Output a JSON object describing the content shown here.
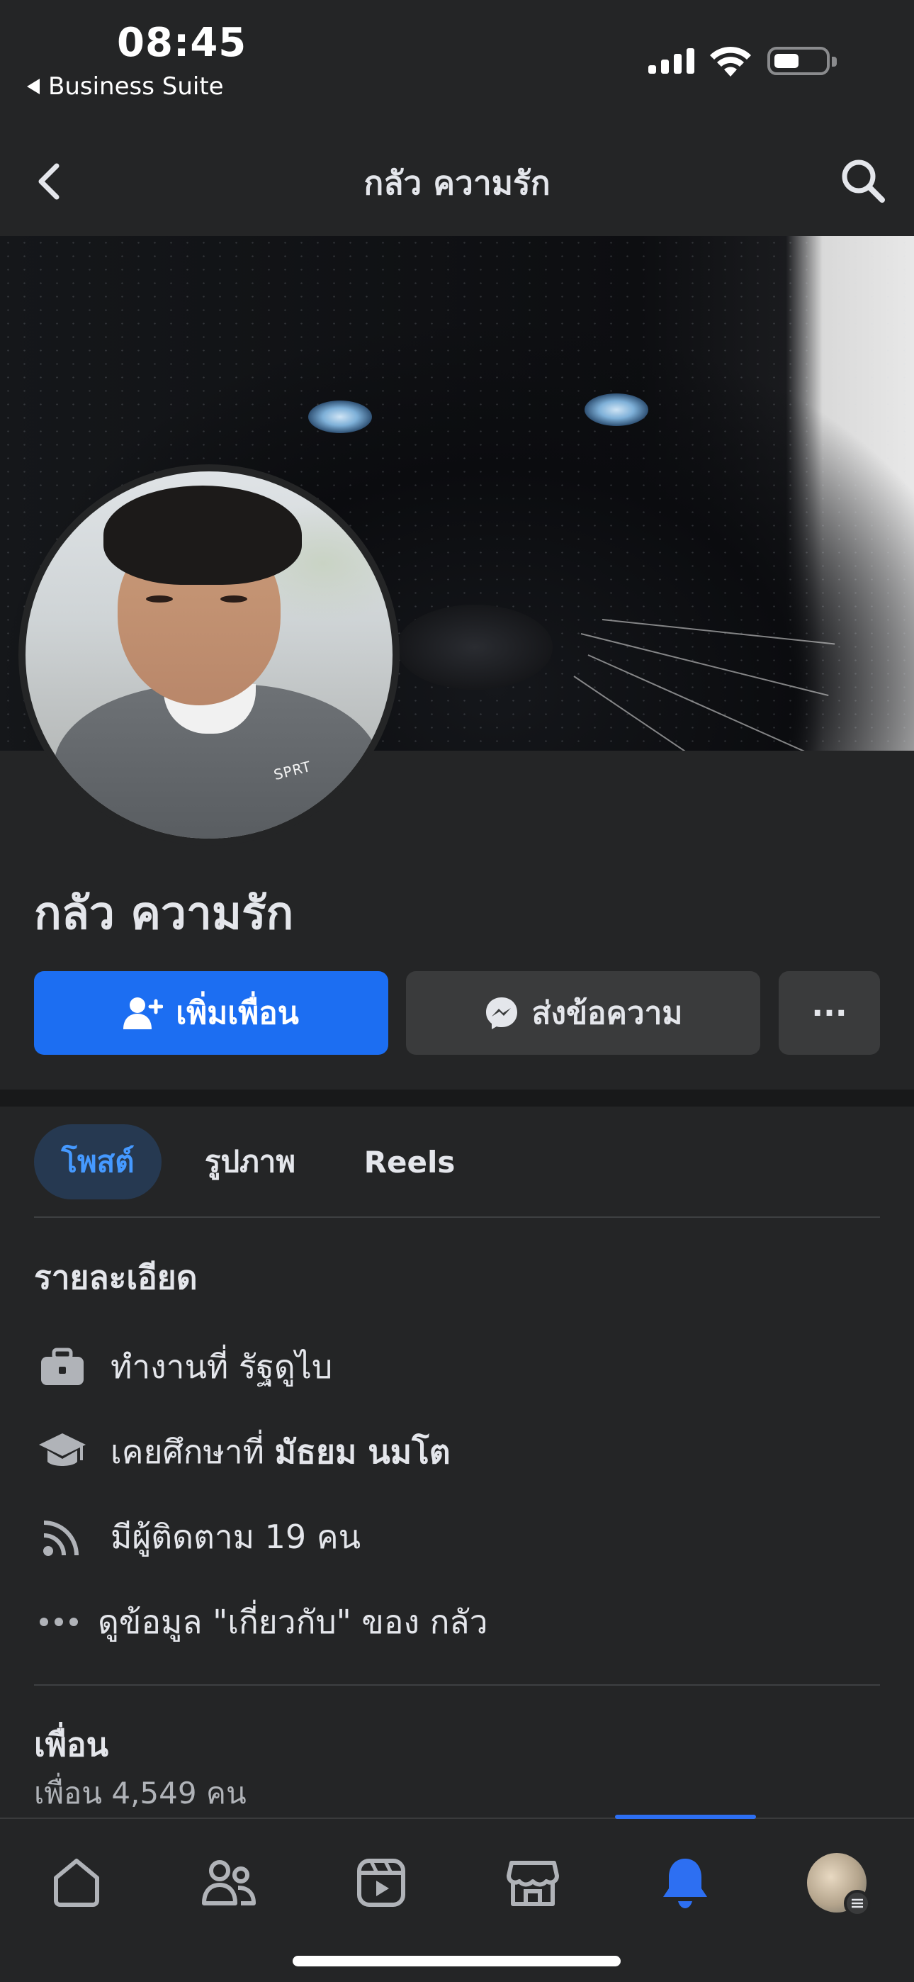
{
  "status_bar": {
    "time": "08:45",
    "back_app": "Business Suite"
  },
  "top_nav": {
    "title": "กลัว ความรัก",
    "back_icon": "chevron-left-icon",
    "search_icon": "search-icon"
  },
  "profile": {
    "name": "กลัว ความรัก",
    "add_friend_label": "เพิ่มเพื่อน",
    "message_label": "ส่งข้อความ",
    "more_label": "···"
  },
  "tabs": [
    {
      "label": "โพสต์",
      "active": true
    },
    {
      "label": "รูปภาพ",
      "active": false
    },
    {
      "label": "Reels",
      "active": false
    }
  ],
  "details": {
    "title": "รายละเอียด",
    "work_prefix": "ทำงานที่ ",
    "work_place": "รัฐดูไบ",
    "education_prefix": "เคยศึกษาที่ ",
    "education_place": "มัธยม นมโต",
    "followers": "มีผู้ติดตาม 19 คน",
    "about_link": "ดูข้อมูล \"เกี่ยวกับ\" ของ กลัว"
  },
  "friends": {
    "title": "เพื่อน",
    "count_text": "เพื่อน 4,549 คน"
  },
  "bottom_nav": {
    "items": [
      "home-icon",
      "friends-icon",
      "video-icon",
      "marketplace-icon",
      "notifications-icon",
      "profile-menu-icon"
    ],
    "active_index": 4
  },
  "colors": {
    "accent": "#1c6ef2",
    "background": "#242526",
    "active_tab_bg": "#263951",
    "active_tab_text": "#4599ff"
  }
}
